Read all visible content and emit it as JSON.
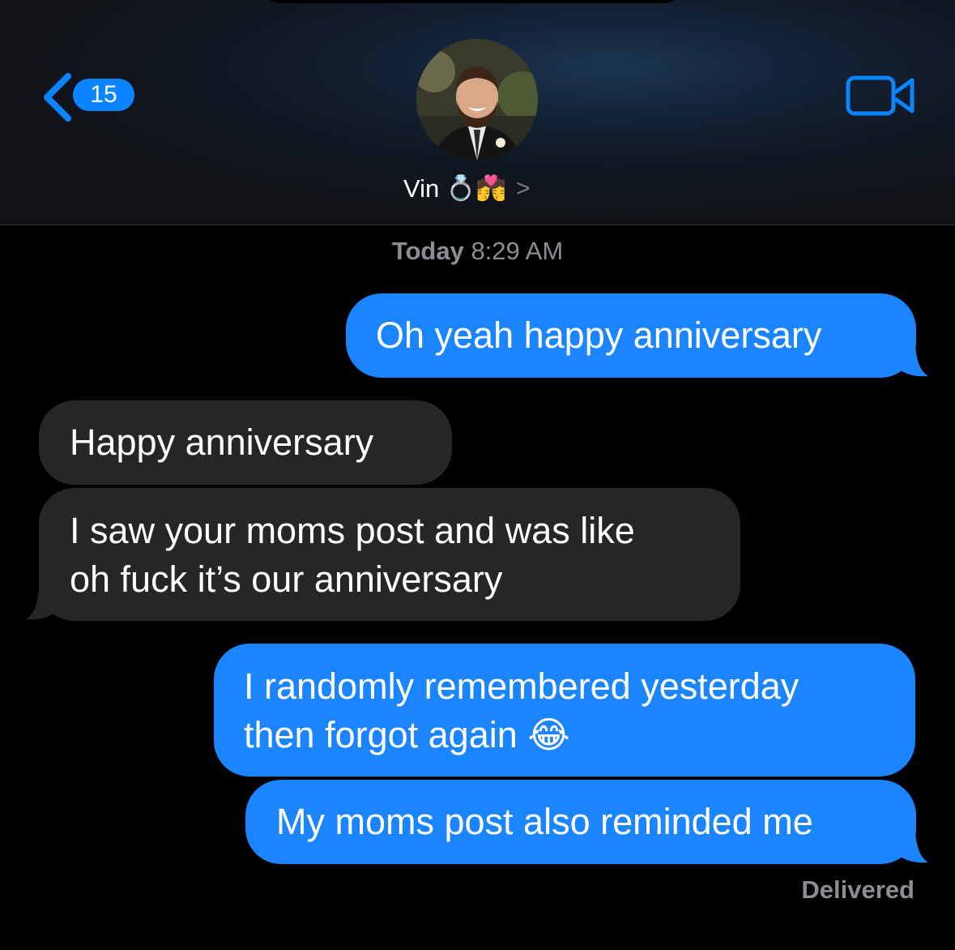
{
  "header": {
    "back_count": "15",
    "contact_name": "Vin",
    "contact_emoji": "💍💏"
  },
  "thread": {
    "timestamp_day": "Today",
    "timestamp_time": "8:29 AM",
    "messages": [
      {
        "from": "me",
        "lines": [
          "Oh yeah happy anniversary"
        ]
      },
      {
        "from": "them",
        "lines": [
          "Happy anniversary"
        ]
      },
      {
        "from": "them",
        "lines": [
          "I saw your moms post and was like",
          "oh fuck it’s our anniversary"
        ]
      },
      {
        "from": "me",
        "lines": [
          "I randomly remembered yesterday",
          "then forgot again 😂"
        ]
      },
      {
        "from": "me",
        "lines": [
          "My moms post also reminded me"
        ]
      }
    ],
    "status": "Delivered"
  },
  "colors": {
    "sent_bubble": "#1a85ff",
    "received_bubble": "#262628",
    "accent": "#0a84ff"
  },
  "icons": [
    "back-chevron-icon",
    "video-camera-icon",
    "contact-chevron-icon"
  ]
}
